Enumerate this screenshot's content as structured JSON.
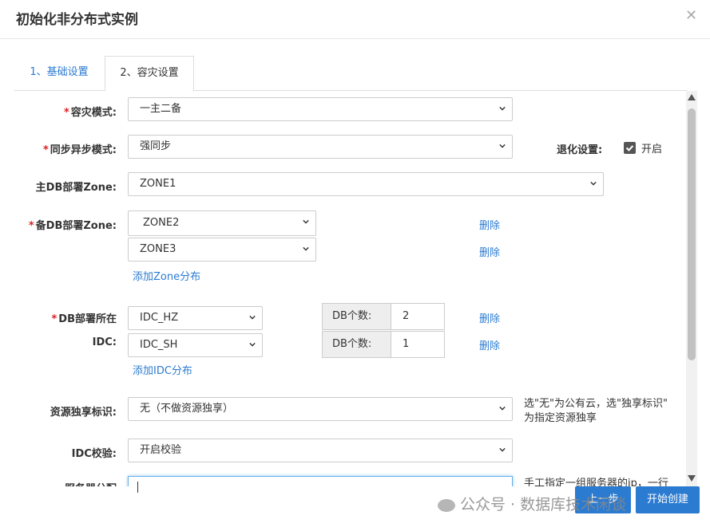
{
  "dialog": {
    "title": "初始化非分布式实例"
  },
  "tabs": [
    {
      "label": "1、基础设置"
    },
    {
      "label": "2、容灾设置"
    }
  ],
  "form": {
    "dr_mode": {
      "label": "容灾模式:",
      "value": "一主二备"
    },
    "sync_mode": {
      "label": "同步异步模式:",
      "value": "强同步"
    },
    "degrade": {
      "label": "退化设置:",
      "checkbox_label": "开启",
      "checked": true
    },
    "primary_zone": {
      "label": "主DB部署Zone:",
      "value": "ZONE1"
    },
    "standby_zone": {
      "label": "备DB部署Zone:",
      "rows": [
        {
          "value": "ZONE2",
          "action": "删除"
        },
        {
          "value": "ZONE3",
          "action": "删除"
        }
      ],
      "add_link": "添加Zone分布"
    },
    "idc": {
      "label_line1": "DB部署所在",
      "label_line2": "IDC:",
      "rows": [
        {
          "value": "IDC_HZ",
          "count_label": "DB个数:",
          "count": "2",
          "action": "删除"
        },
        {
          "value": "IDC_SH",
          "count_label": "DB个数:",
          "count": "1",
          "action": "删除"
        }
      ],
      "add_link": "添加IDC分布"
    },
    "resource_tag": {
      "label": "资源独享标识:",
      "value": "无（不做资源独享）",
      "hint_line1": "选\"无\"为公有云，选\"独享标识\"",
      "hint_line2": "为指定资源独享"
    },
    "idc_check": {
      "label": "IDC校验:",
      "value": "开启校验"
    },
    "server_group": {
      "label": "服务器分配",
      "hint": "手工指定一组服务器的ip，一行"
    }
  },
  "buttons": {
    "prev": "上一步",
    "start": "开始创建"
  },
  "watermark": {
    "text": "公众号 · 数据库技术闲谈"
  },
  "colors": {
    "accent": "#2b7bd1",
    "required": "#e02020"
  }
}
